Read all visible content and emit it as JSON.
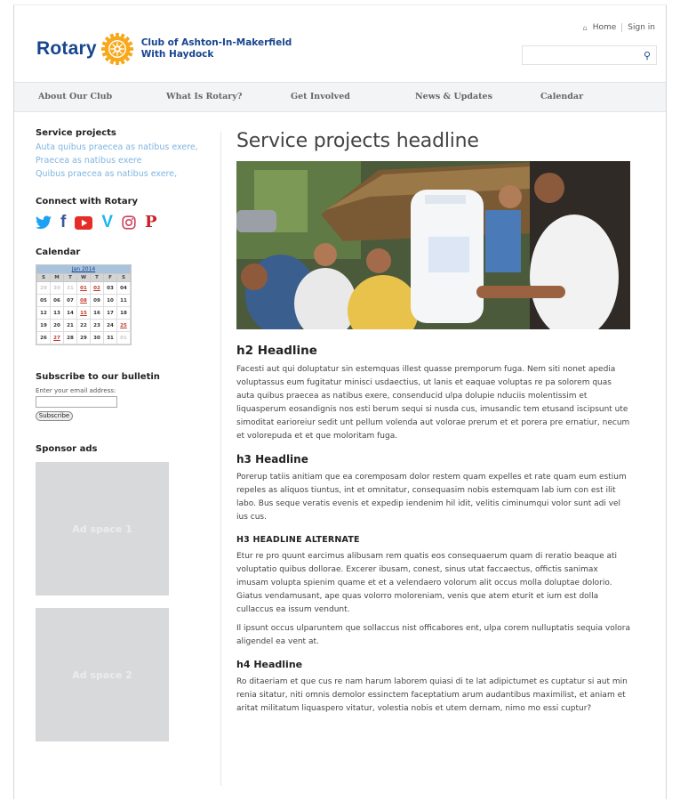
{
  "header": {
    "brand": "Rotary",
    "club_line1": "Club of Ashton-In-Makerfield",
    "club_line2": "With Haydock",
    "home_link": "Home",
    "signin_link": "Sign in",
    "search_placeholder": ""
  },
  "nav": [
    "About Our Club",
    "What Is Rotary?",
    "Get Involved",
    "News & Updates",
    "Calendar"
  ],
  "sidebar": {
    "service_heading": "Service projects",
    "service_links": [
      "Auta quibus praecea as natibus exere,",
      "Praecea as natibus exere",
      "Quibus praecea as natibus exere,"
    ],
    "connect_heading": "Connect with Rotary",
    "social_icons": [
      "twitter-icon",
      "facebook-icon",
      "youtube-icon",
      "vimeo-icon",
      "instagram-icon",
      "pinterest-icon"
    ],
    "calendar_heading": "Calendar",
    "calendar": {
      "month": "Jan 2014",
      "weekdays": [
        "S",
        "M",
        "T",
        "W",
        "T",
        "F",
        "S"
      ],
      "weeks": [
        [
          {
            "d": "29",
            "s": "dim"
          },
          {
            "d": "30",
            "s": "dim"
          },
          {
            "d": "31",
            "s": "dim"
          },
          {
            "d": "01",
            "s": "red"
          },
          {
            "d": "02",
            "s": "red"
          },
          {
            "d": "03",
            "s": ""
          },
          {
            "d": "04",
            "s": ""
          }
        ],
        [
          {
            "d": "05",
            "s": ""
          },
          {
            "d": "06",
            "s": ""
          },
          {
            "d": "07",
            "s": ""
          },
          {
            "d": "08",
            "s": "red"
          },
          {
            "d": "09",
            "s": ""
          },
          {
            "d": "10",
            "s": ""
          },
          {
            "d": "11",
            "s": ""
          }
        ],
        [
          {
            "d": "12",
            "s": ""
          },
          {
            "d": "13",
            "s": ""
          },
          {
            "d": "14",
            "s": ""
          },
          {
            "d": "15",
            "s": "red"
          },
          {
            "d": "16",
            "s": ""
          },
          {
            "d": "17",
            "s": ""
          },
          {
            "d": "18",
            "s": ""
          }
        ],
        [
          {
            "d": "19",
            "s": ""
          },
          {
            "d": "20",
            "s": ""
          },
          {
            "d": "21",
            "s": ""
          },
          {
            "d": "22",
            "s": ""
          },
          {
            "d": "23",
            "s": ""
          },
          {
            "d": "24",
            "s": ""
          },
          {
            "d": "25",
            "s": "red"
          }
        ],
        [
          {
            "d": "26",
            "s": ""
          },
          {
            "d": "27",
            "s": "red"
          },
          {
            "d": "28",
            "s": ""
          },
          {
            "d": "29",
            "s": ""
          },
          {
            "d": "30",
            "s": ""
          },
          {
            "d": "31",
            "s": ""
          },
          {
            "d": "01",
            "s": "dim"
          }
        ]
      ]
    },
    "subscribe_heading": "Subscribe to our bulletin",
    "email_label": "Enter your email address:",
    "subscribe_button": "Subscribe",
    "sponsor_heading": "Sponsor ads",
    "ads": [
      "Ad space 1",
      "Ad space 2"
    ]
  },
  "main": {
    "title": "Service projects headline",
    "h2": "h2 Headline",
    "p1": "Facesti aut qui doluptatur sin estemquas illest quasse premporum fuga. Nem siti nonet apedia voluptassus eum fugitatur minisci usdaectius, ut lanis et eaquae voluptas re pa solorem quas auta quibus praecea as natibus exere, consenducid ulpa dolupie nduciis molentissim et liquasperum eosandignis nos esti berum sequi si nusda cus, imusandic tem etusand iscipsunt ute simoditat earioreiur sedit unt pellum volenda aut volorae prerum et et porera pre ernatiur, necum et volorepuda et et que moloritam fuga.",
    "h3": "h3 Headline",
    "p2": "Porerup tatiis anitiam que ea coremposam dolor restem quam expelles et rate quam eum estium repeles as aliquos tiuntus, int et omnitatur, consequasim nobis estemquam lab ium con est ilit labo. Bus seque veratis evenis et expedip iendenim hil idit, velitis ciminumqui volor sunt adi vel ius cus.",
    "h3alt": "H3 HEADLINE ALTERNATE",
    "p3": "Etur re pro quunt earcimus alibusam rem quatis eos consequaerum quam di reratio beaque ati voluptatio quibus dollorae. Excerer ibusam, conest, sinus utat faccaectus, offictis sanimax imusam volupta spienim quame et et a velendaero volorum alit occus molla doluptae dolorio. Giatus vendamusant, ape quas volorro moloreniam, venis que atem eturit et ium est dolla cullaccus ea issum vendunt.",
    "p4": "Il ipsunt occus ulparuntem que sollaccus nist officabores ent, ulpa corem nulluptatis sequia volora aligendel ea vent at.",
    "h4": "h4 Headline",
    "p5": "Ro ditaeriam et que cus re nam harum laborem quiasi di te lat adipictumet es cuptatur si aut min renia sitatur, niti omnis demolor essinctem faceptatium arum audantibus maximilist, et aniam et aritat militatum liquaspero vitatur, volestia nobis et utem dernam, nimo mo essi cuptur?"
  },
  "colors": {
    "brand_blue": "#17458f",
    "gold": "#f7a81b",
    "link_light_blue": "#7fb5e0",
    "nav_bg": "#f3f4f6",
    "ad_gray": "#d8d9da"
  }
}
